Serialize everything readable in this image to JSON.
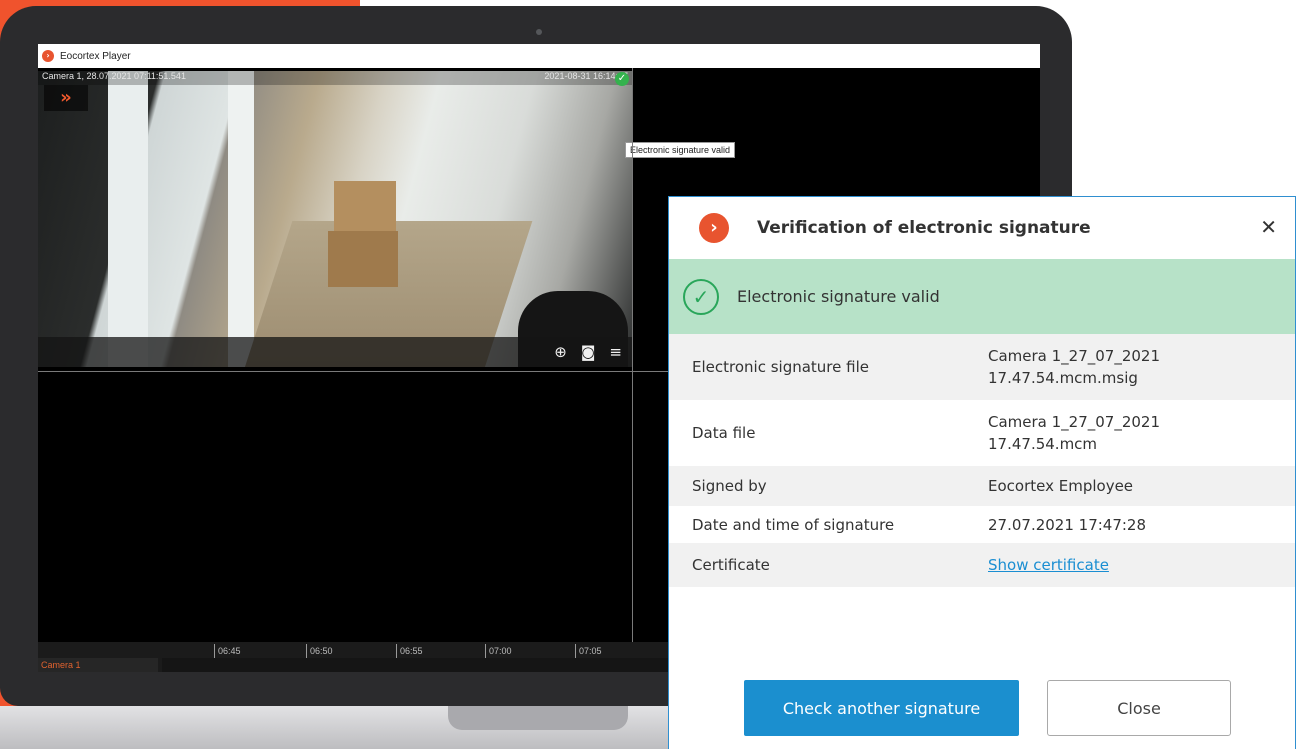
{
  "player": {
    "window_title": "Eocortex Player",
    "camera_overlay_left": "Camera 1, 28.07.2021 07:11:51.541",
    "camera_overlay_right": "2021-08-31 16:14:37",
    "expand_glyph": "»",
    "tooltip": "Electronic signature valid",
    "toolbar_icons": [
      "zoom-in-icon",
      "snapshot-icon",
      "menu-icon"
    ],
    "timeline_ticks": [
      "06:45",
      "06:50",
      "06:55",
      "07:00",
      "07:05"
    ],
    "timeline_camera": "Camera 1"
  },
  "dialog": {
    "title": "Verification of electronic signature",
    "close_glyph": "✕",
    "status_text": "Electronic signature valid",
    "rows": [
      {
        "label": "Electronic signature file",
        "value_line1": "Camera 1_27_07_2021",
        "value_line2": "17.47.54.mcm.msig"
      },
      {
        "label": "Data file",
        "value_line1": "Camera 1_27_07_2021",
        "value_line2": "17.47.54.mcm"
      },
      {
        "label": "Signed by",
        "value": "Eocortex Employee"
      },
      {
        "label": "Date and time of signature",
        "value": "27.07.2021 17:47:28"
      },
      {
        "label": "Certificate",
        "link": "Show certificate"
      }
    ],
    "btn_check_another": "Check another signature",
    "btn_close": "Close"
  },
  "colors": {
    "brand_orange": "#f0532d",
    "accent_blue": "#1b8fcf",
    "success_green": "#29a65a",
    "success_bg": "#b7e2c8"
  }
}
